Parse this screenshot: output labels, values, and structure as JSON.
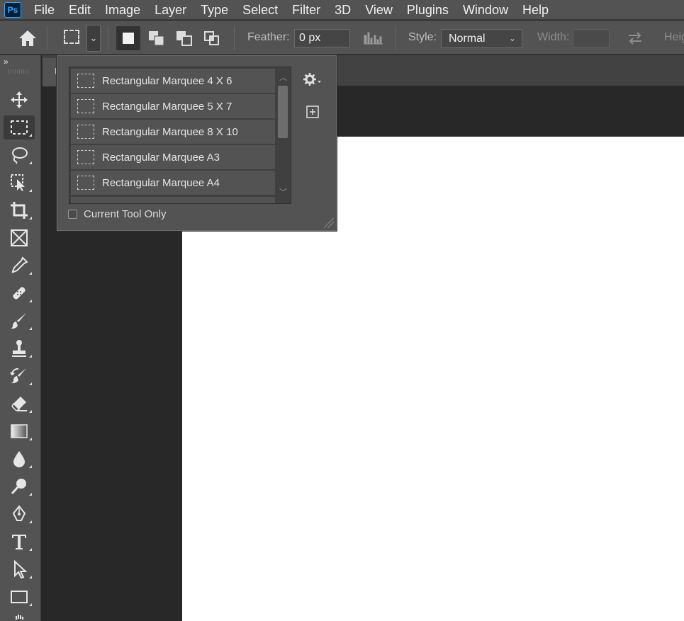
{
  "app": {
    "logo_text": "Ps"
  },
  "menu": [
    "File",
    "Edit",
    "Image",
    "Layer",
    "Type",
    "Select",
    "Filter",
    "3D",
    "View",
    "Plugins",
    "Window",
    "Help"
  ],
  "options_bar": {
    "feather_label": "Feather:",
    "feather_value": "0 px",
    "style_label": "Style:",
    "style_value": "Normal",
    "width_label": "Width:",
    "width_value": "",
    "height_label_partial": "Heig"
  },
  "toolbar": {
    "collapse_icon": "»",
    "tools": [
      "move-tool",
      "rectangular-marquee-tool",
      "lasso-tool",
      "object-selection-tool",
      "crop-tool",
      "frame-tool",
      "eyedropper-tool",
      "spot-healing-brush-tool",
      "brush-tool",
      "clone-stamp-tool",
      "history-brush-tool",
      "eraser-tool",
      "gradient-tool",
      "blur-tool",
      "dodge-tool",
      "pen-tool",
      "type-tool",
      "path-selection-tool",
      "rectangle-tool",
      "hand-tool"
    ],
    "active_tool": "rectangular-marquee-tool"
  },
  "document": {
    "tab_label_partial": "U"
  },
  "preset_picker": {
    "items": [
      "Rectangular Marquee 4 X 6",
      "Rectangular Marquee 5 X 7",
      "Rectangular Marquee 8 X 10",
      "Rectangular Marquee A3",
      "Rectangular Marquee A4"
    ],
    "current_tool_only_label": "Current Tool Only",
    "current_tool_only_checked": false
  },
  "colors": {
    "chrome": "#535353",
    "panel_dark": "#404040",
    "pasteboard": "#282828",
    "canvas": "#ffffff",
    "ps_blue": "#31a8ff"
  }
}
